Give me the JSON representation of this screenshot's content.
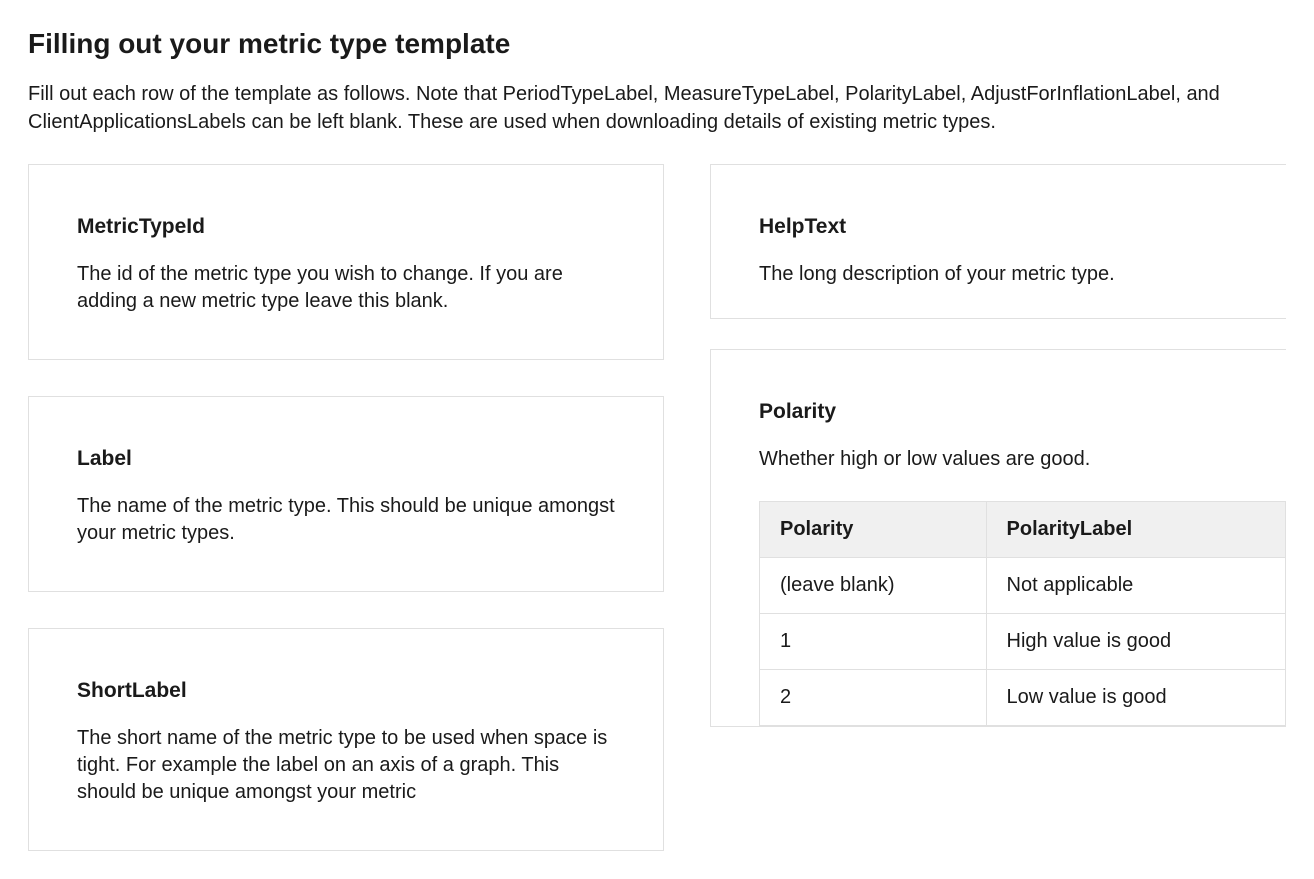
{
  "page": {
    "title": "Filling out your metric type template",
    "intro": "Fill out each row of the template as follows. Note that PeriodTypeLabel, MeasureTypeLabel, PolarityLabel, AdjustForInflationLabel, and ClientApplicationsLabels can be left blank. These are used when downloading details of existing metric types."
  },
  "cards": {
    "metricTypeId": {
      "title": "MetricTypeId",
      "desc": "The id of the metric type you wish to change. If you are adding a new metric type leave this blank."
    },
    "label": {
      "title": "Label",
      "desc": "The name of the metric type. This should be unique amongst your metric types."
    },
    "shortLabel": {
      "title": "ShortLabel",
      "desc": "The short name of the metric type to be used when space is tight. For example the label on an axis of a graph. This should be unique amongst your metric"
    },
    "helpText": {
      "title": "HelpText",
      "desc": "The long description of your metric type."
    },
    "polarity": {
      "title": "Polarity",
      "desc": "Whether high or low values are good.",
      "table": {
        "headers": {
          "col1": "Polarity",
          "col2": "PolarityLabel"
        },
        "rows": [
          {
            "col1": "(leave blank)",
            "col2": "Not applicable"
          },
          {
            "col1": "1",
            "col2": "High value is good"
          },
          {
            "col1": "2",
            "col2": "Low value is good"
          }
        ]
      }
    }
  }
}
